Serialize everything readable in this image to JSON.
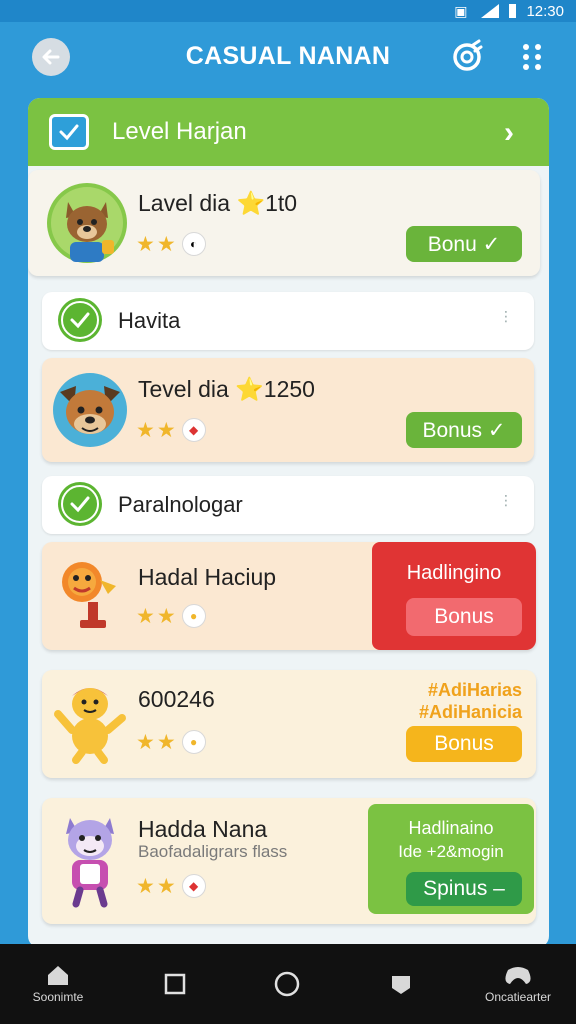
{
  "status_bar": {
    "time": "12:30"
  },
  "app_bar": {
    "title": "CASUAL NANAN"
  },
  "level_header": {
    "title": "Level Harjan"
  },
  "cards": [
    {
      "title": "Lavel dia ⭐1t0",
      "bonus_label": "Bonu ✓",
      "avatar": "bear-character-icon"
    },
    {
      "title": "Tevel dia ⭐1250",
      "bonus_label": "Bonus ✓",
      "avatar": "dog-character-icon"
    },
    {
      "title": "Hadal Haciup",
      "side_title": "Hadlingino",
      "bonus_label": "Bonus",
      "avatar": "trophy-character-icon"
    },
    {
      "title": "600246",
      "side_line1": "#AdiHarias",
      "side_line2": "#AdiHanicia",
      "bonus_label": "Bonus",
      "avatar": "waving-character-icon"
    },
    {
      "title": "Hadda Nana",
      "subtitle": "Baofadaligrars flass",
      "side_line1": "Hadlinaino",
      "side_line2": "Ide +2&mogin",
      "bonus_label": "Spinus –",
      "avatar": "cat-character-icon"
    }
  ],
  "check_rows": [
    {
      "label": "Havita"
    },
    {
      "label": "Paralnologar"
    }
  ],
  "nav": [
    {
      "label": "Soonimte",
      "icon": "home-icon"
    },
    {
      "label": "",
      "icon": "square-icon"
    },
    {
      "label": "",
      "icon": "circle-icon"
    },
    {
      "label": "",
      "icon": "chat-icon"
    },
    {
      "label": "Oncatiearter",
      "icon": "gamepad-icon"
    }
  ],
  "colors": {
    "background": "#2f9ad8",
    "header_green": "#7bc242",
    "bonus_green": "#6ab43b",
    "bonus_red": "#e03434",
    "bonus_orange": "#f5b51c",
    "card_peach": "#fbe8d2"
  }
}
